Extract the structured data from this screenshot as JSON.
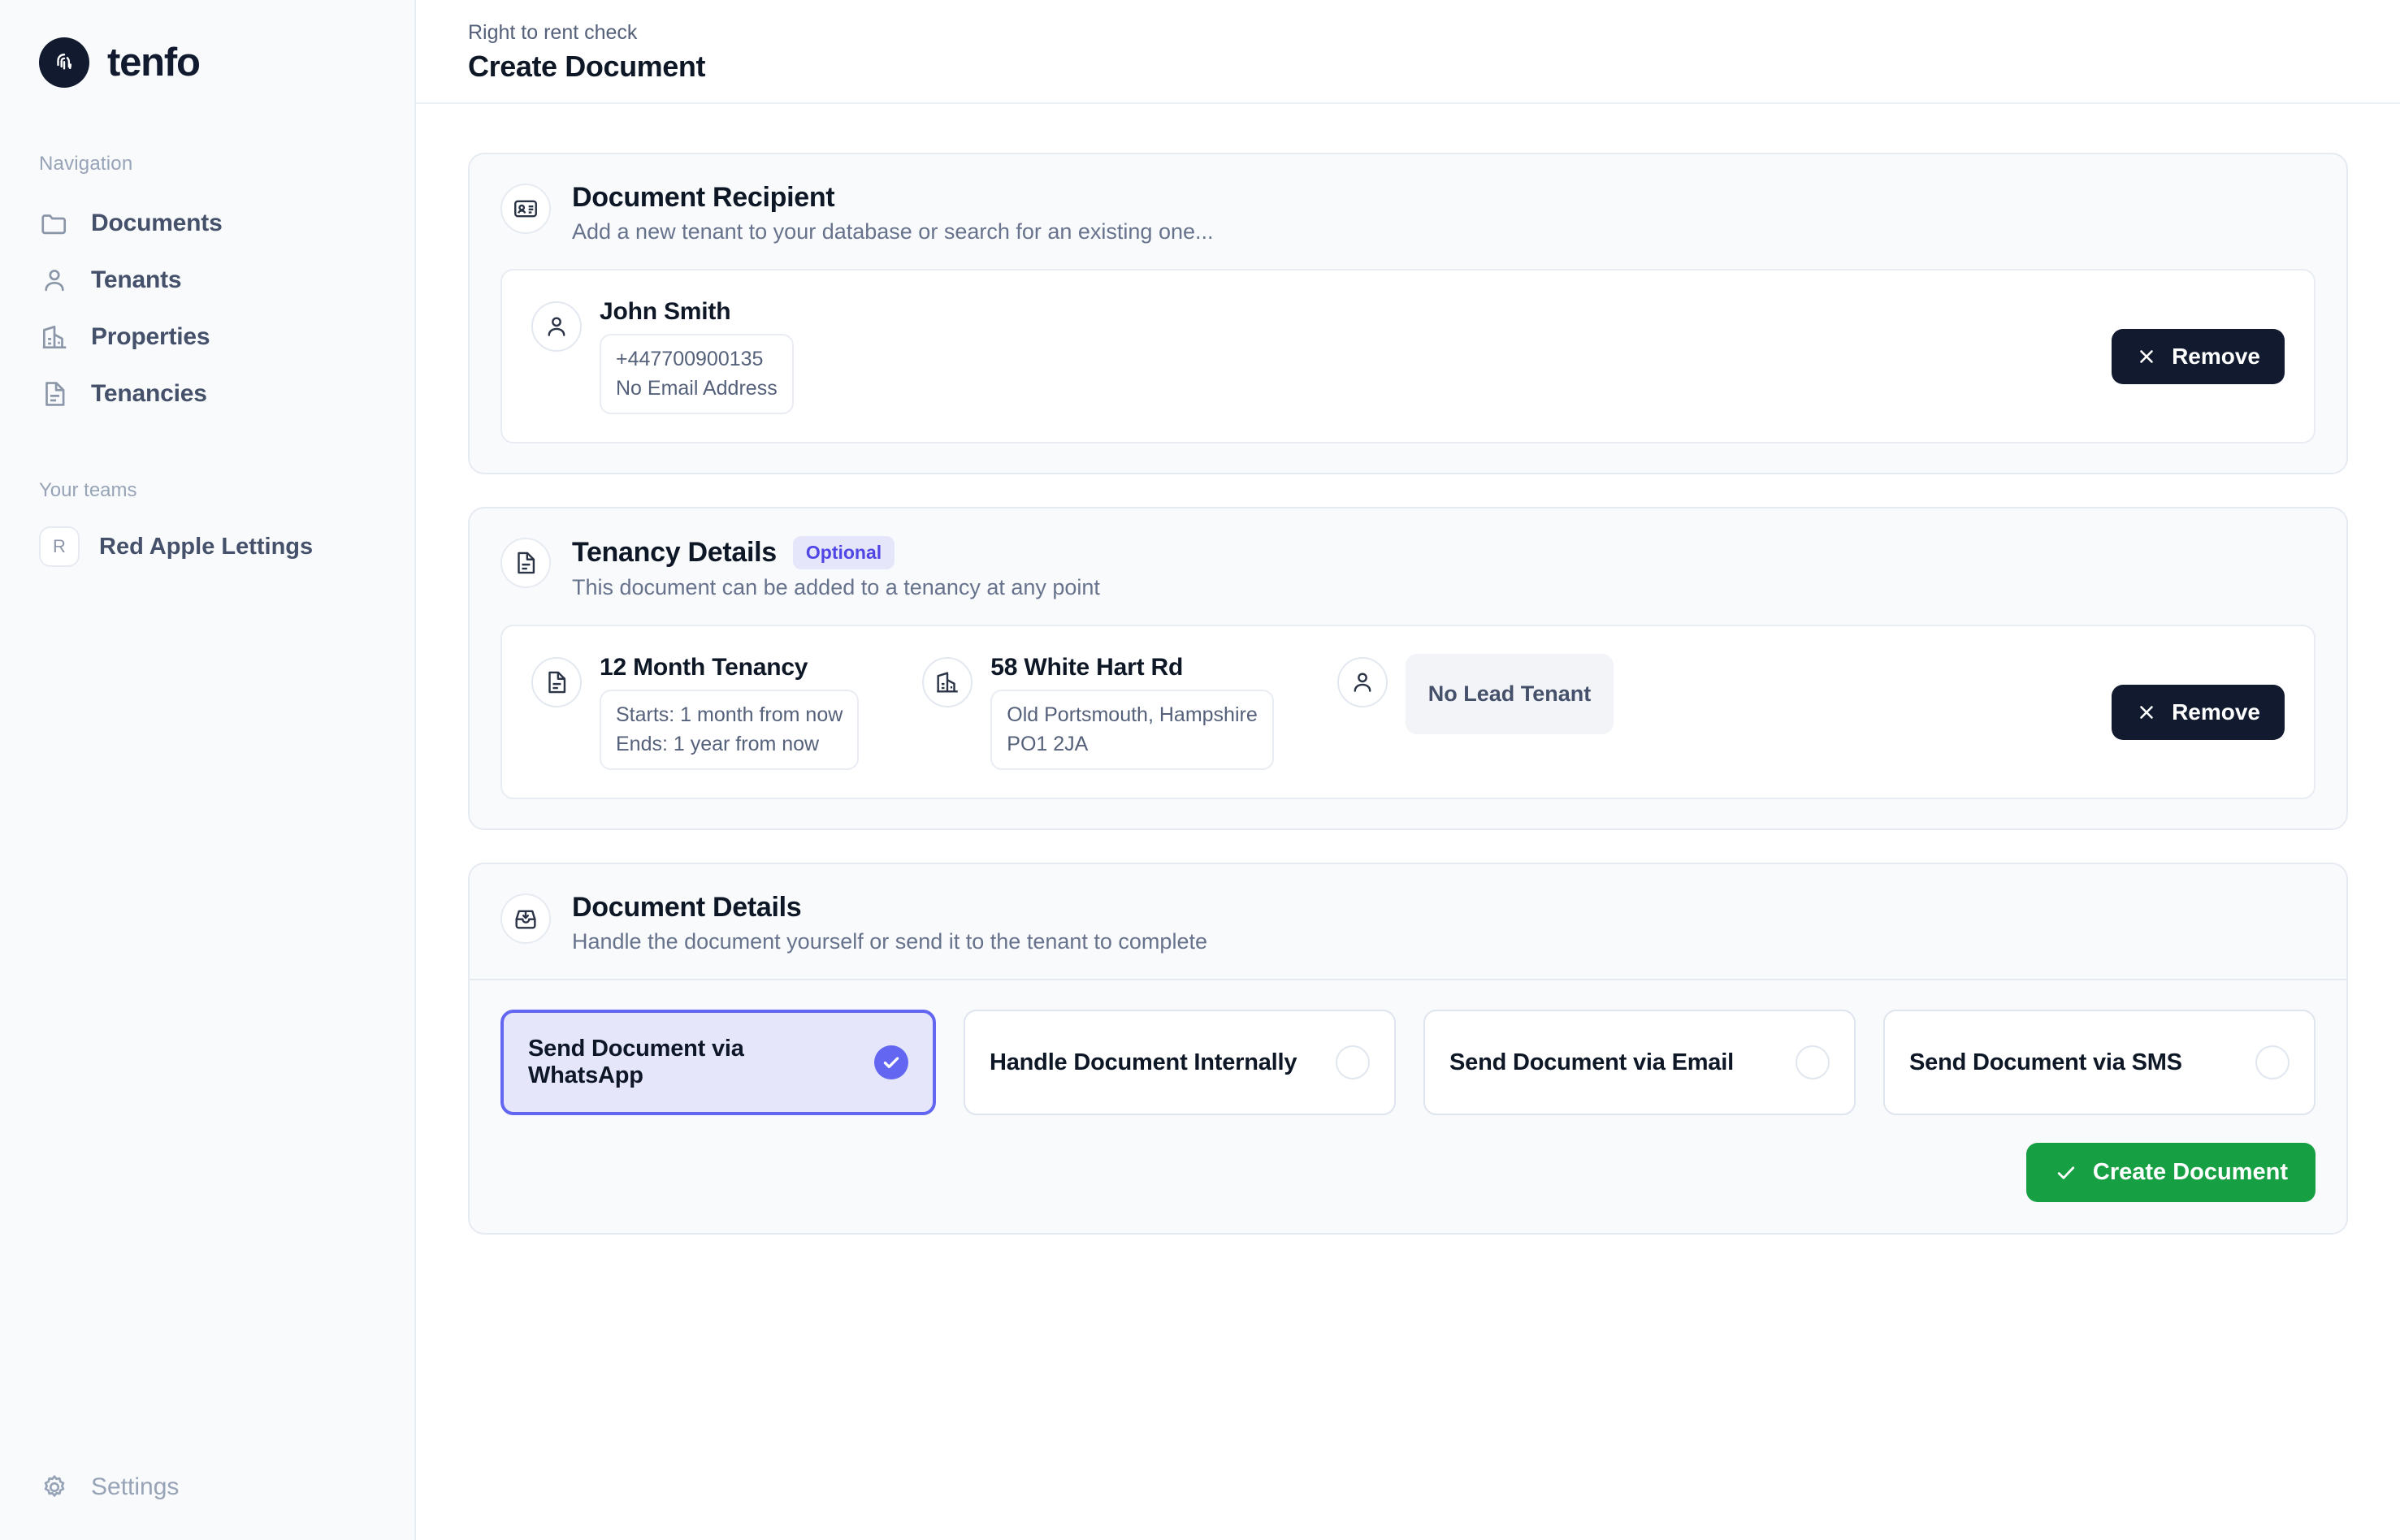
{
  "brand": {
    "name": "tenfo",
    "logo_icon": "fingerprint-icon"
  },
  "sidebar": {
    "nav_caption": "Navigation",
    "items": [
      {
        "label": "Documents",
        "icon": "folder-icon"
      },
      {
        "label": "Tenants",
        "icon": "user-icon"
      },
      {
        "label": "Properties",
        "icon": "building-icon"
      },
      {
        "label": "Tenancies",
        "icon": "document-icon"
      }
    ],
    "teams_caption": "Your teams",
    "teams": [
      {
        "label": "Red Apple Lettings",
        "initial": "R"
      }
    ],
    "settings_label": "Settings",
    "settings_icon": "gear-icon"
  },
  "header": {
    "eyebrow": "Right to rent check",
    "title": "Create Document"
  },
  "recipient_section": {
    "icon": "contact-card-icon",
    "title": "Document Recipient",
    "subtitle": "Add a new tenant to your database or search for an existing one...",
    "tenant": {
      "avatar_icon": "user-icon",
      "name": "John Smith",
      "phone": "+447700900135",
      "email": "No Email Address"
    },
    "remove_label": "Remove",
    "remove_icon": "close-icon"
  },
  "tenancy_section": {
    "icon": "document-icon",
    "title": "Tenancy Details",
    "badge": "Optional",
    "subtitle": "This document can be added to a tenancy at any point",
    "tenancy": {
      "icon": "document-icon",
      "name": "12 Month Tenancy",
      "starts": "Starts: 1 month from now",
      "ends": "Ends: 1 year from now"
    },
    "property": {
      "icon": "building-icon",
      "name": "58 White Hart Rd",
      "address_line1": "Old Portsmouth, Hampshire",
      "address_line2": "PO1 2JA"
    },
    "lead_tenant": {
      "icon": "user-icon",
      "status": "No Lead Tenant"
    },
    "remove_label": "Remove",
    "remove_icon": "close-icon"
  },
  "details_section": {
    "icon": "inbox-download-icon",
    "title": "Document Details",
    "subtitle": "Handle the document yourself or send it to the tenant to complete",
    "options": [
      {
        "label": "Send Document via WhatsApp",
        "selected": true
      },
      {
        "label": "Handle Document Internally",
        "selected": false
      },
      {
        "label": "Send Document via Email",
        "selected": false
      },
      {
        "label": "Send Document via SMS",
        "selected": false
      }
    ],
    "submit_label": "Create Document",
    "submit_icon": "check-icon"
  },
  "colors": {
    "brand_dark": "#111a2e",
    "accent_indigo": "#6366f1",
    "badge_bg": "#e6e6fb",
    "success_green": "#17a043",
    "sidebar_bg": "#f8fafc",
    "card_bg": "#f8fafc"
  }
}
